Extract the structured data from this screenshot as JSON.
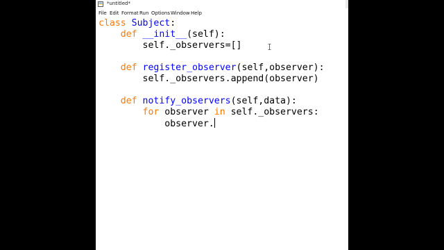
{
  "window": {
    "title": "*untitled*"
  },
  "menu": [
    "File",
    "Edit",
    "Format",
    "Run",
    "Options",
    "Window",
    "Help"
  ],
  "colors": {
    "keyword": "#ff7700",
    "definition": "#0000ff",
    "text": "#000000"
  },
  "code": {
    "line1": {
      "kw": "class",
      "name": "Subject",
      "rest": ":"
    },
    "line2": {
      "kw": "def",
      "name": "__init__",
      "rest": "(self):"
    },
    "line3": {
      "text": "self._observers=[]"
    },
    "line4": {
      "kw": "def",
      "name": "register_observer",
      "rest": "(self,observer):"
    },
    "line5": {
      "text": "self._observers.append(observer)"
    },
    "line6": {
      "kw": "def",
      "name": "notify_observers",
      "rest": "(self,data):"
    },
    "line7": {
      "kw1": "for",
      "mid": " observer ",
      "kw2": "in",
      "rest": " self._observers:"
    },
    "line8": {
      "text": "observer."
    }
  },
  "icons": {
    "app": "python-idle-icon",
    "mouse_pointer": "text-cursor-icon"
  }
}
